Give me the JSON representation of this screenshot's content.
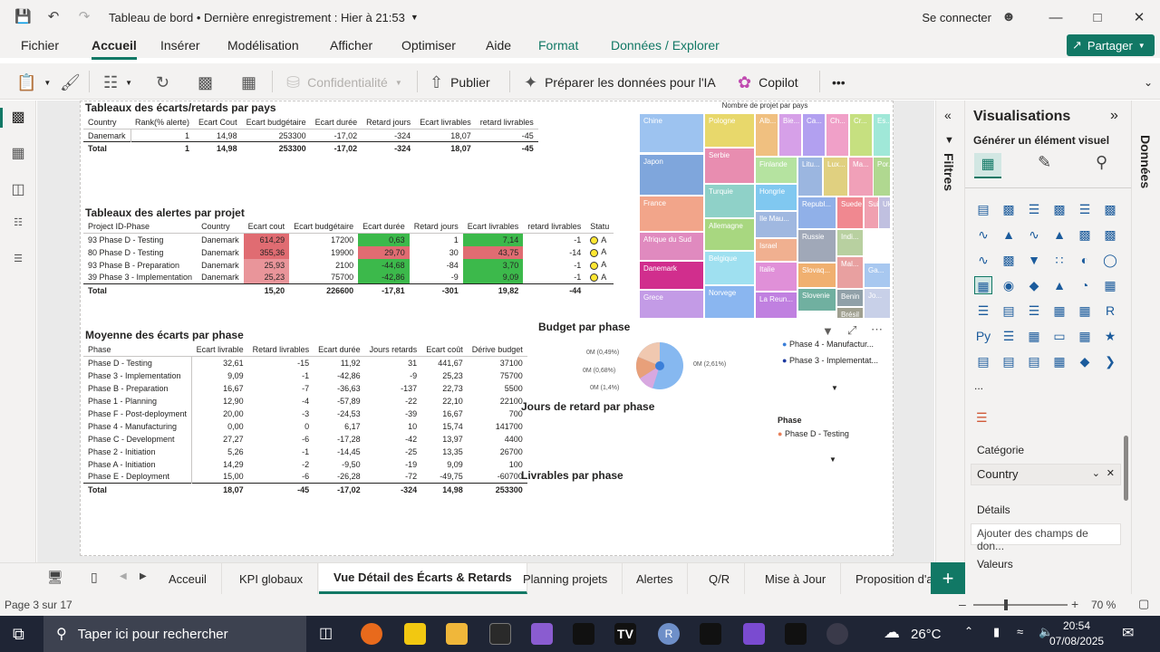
{
  "titlebar": {
    "title": "Tableau de bord • Dernière enregistrement : Hier à 21:53",
    "signin": "Se connecter"
  },
  "menu": {
    "tabs": [
      "Fichier",
      "Accueil",
      "Insérer",
      "Modélisation",
      "Afficher",
      "Optimiser",
      "Aide",
      "Format",
      "Données / Explorer"
    ],
    "share": "Partager"
  },
  "ribbon": {
    "confidentiality": "Confidentialité",
    "publish": "Publier",
    "prepare_ai": "Préparer les données pour l'IA",
    "copilot": "Copilot",
    "more": "•••"
  },
  "visuals": {
    "ecarts_title": "Tableaux des écarts/retards par pays",
    "ecarts_headers": [
      "Country",
      "Rank(% alerte)",
      "Ecart Cout",
      "Ecart budgétaire",
      "Ecart durée",
      "Retard jours",
      "Ecart livrables",
      "retard livrables"
    ],
    "ecarts_rows": [
      [
        "Danemark",
        "1",
        "14,98",
        "253300",
        "-17,02",
        "-324",
        "18,07",
        "-45"
      ]
    ],
    "ecarts_total": [
      "Total",
      "1",
      "14,98",
      "253300",
      "-17,02",
      "-324",
      "18,07",
      "-45"
    ],
    "alertes_title": "Tableaux des alertes par projet",
    "alertes_headers": [
      "Project ID-Phase",
      "Country",
      "Ecart cout",
      "Ecart budgétaire",
      "Ecart durée",
      "Retard jours",
      "Ecart livrables",
      "retard livrables",
      "Statu"
    ],
    "alertes_rows": [
      [
        "93 Phase D - Testing",
        "Danemark",
        "614,29",
        "17200",
        "0,63",
        "1",
        "7,14",
        "-1",
        "A"
      ],
      [
        "80 Phase D - Testing",
        "Danemark",
        "355,36",
        "19900",
        "29,70",
        "30",
        "43,75",
        "-14",
        "A"
      ],
      [
        "93 Phase B - Preparation",
        "Danemark",
        "25,93",
        "2100",
        "-44,68",
        "-84",
        "3,70",
        "-1",
        "A"
      ],
      [
        "39 Phase 3 - Implementation",
        "Danemark",
        "25,23",
        "75700",
        "-42,86",
        "-9",
        "9,09",
        "-1",
        "A"
      ]
    ],
    "alertes_total": [
      "Total",
      "",
      "15,20",
      "226600",
      "-17,81",
      "-301",
      "19,82",
      "-44",
      ""
    ],
    "moyenne_title": "Moyenne des écarts par phase",
    "moyenne_headers": [
      "Phase",
      "Ecart livrable",
      "Retard livrables",
      "Ecart durée",
      "Jours retards",
      "Ecart coût",
      "Dérive budget"
    ],
    "moyenne_rows": [
      [
        "Phase D - Testing",
        "32,61",
        "-15",
        "11,92",
        "31",
        "441,67",
        "37100"
      ],
      [
        "Phase 3 - Implementation",
        "9,09",
        "-1",
        "-42,86",
        "-9",
        "25,23",
        "75700"
      ],
      [
        "Phase B - Preparation",
        "16,67",
        "-7",
        "-36,63",
        "-137",
        "22,73",
        "5500"
      ],
      [
        "Phase 1 - Planning",
        "12,90",
        "-4",
        "-57,89",
        "-22",
        "22,10",
        "22100"
      ],
      [
        "Phase F - Post-deployment",
        "20,00",
        "-3",
        "-24,53",
        "-39",
        "16,67",
        "700"
      ],
      [
        "Phase 4 - Manufacturing",
        "0,00",
        "0",
        "6,17",
        "10",
        "15,74",
        "141700"
      ],
      [
        "Phase C - Development",
        "27,27",
        "-6",
        "-17,28",
        "-42",
        "13,97",
        "4400"
      ],
      [
        "Phase 2 - Initiation",
        "5,26",
        "-1",
        "-14,45",
        "-25",
        "13,35",
        "26700"
      ],
      [
        "Phase A - Initiation",
        "14,29",
        "-2",
        "-9,50",
        "-19",
        "9,09",
        "100"
      ],
      [
        "Phase E - Deployment",
        "15,00",
        "-6",
        "-26,28",
        "-72",
        "-49,75",
        "-60700"
      ]
    ],
    "moyenne_total": [
      "Total",
      "18,07",
      "-45",
      "-17,02",
      "-324",
      "14,98",
      "253300"
    ],
    "treemap_title": "Nombre de projet par pays",
    "treemap_cells": [
      {
        "label": "Chine",
        "color": "#9dc3f0"
      },
      {
        "label": "Japon",
        "color": "#7fa6dc"
      },
      {
        "label": "France",
        "color": "#f2a58a"
      },
      {
        "label": "Afrique du Sud",
        "color": "#e08abf"
      },
      {
        "label": "Danemark",
        "color": "#d12e8d"
      },
      {
        "label": "Grece",
        "color": "#c39be6"
      },
      {
        "label": "Pologne",
        "color": "#e8d86b"
      },
      {
        "label": "Serbie",
        "color": "#e88db0"
      },
      {
        "label": "Turquie",
        "color": "#8fd1c8"
      },
      {
        "label": "Allemagne",
        "color": "#a8d780"
      },
      {
        "label": "Belgique",
        "color": "#9fe0f0"
      },
      {
        "label": "Norvege",
        "color": "#8ab6f0"
      },
      {
        "label": "Alb...",
        "color": "#f0c080"
      },
      {
        "label": "Bie...",
        "color": "#d6a0e8"
      },
      {
        "label": "Ca...",
        "color": "#b2a0f0"
      },
      {
        "label": "Ch...",
        "color": "#f0a0c8"
      },
      {
        "label": "Cr...",
        "color": "#c6e080"
      },
      {
        "label": "Es...",
        "color": "#a0e8d8"
      },
      {
        "label": "Finlande",
        "color": "#b5e3a0"
      },
      {
        "label": "Litu...",
        "color": "#9bb6e0"
      },
      {
        "label": "Lux...",
        "color": "#e0d080"
      },
      {
        "label": "Ma...",
        "color": "#f0a0b8"
      },
      {
        "label": "Ma...",
        "color": "#98e0c8"
      },
      {
        "label": "Por...",
        "color": "#b0d890"
      },
      {
        "label": "Hongrie",
        "color": "#80c8f0"
      },
      {
        "label": "Ile Mau...",
        "color": "#a0b8e0"
      },
      {
        "label": "Israel",
        "color": "#f0b090"
      },
      {
        "label": "Italie",
        "color": "#e090d8"
      },
      {
        "label": "La Reun...",
        "color": "#c080e0"
      },
      {
        "label": "Republ...",
        "color": "#90b0e8"
      },
      {
        "label": "Suede",
        "color": "#f08890"
      },
      {
        "label": "Suisse",
        "color": "#f0a0b0"
      },
      {
        "label": "Ukra...",
        "color": "#c0c0e0"
      },
      {
        "label": "Russie",
        "color": "#a0a8b8"
      },
      {
        "label": "Indi...",
        "color": "#b8d0a0"
      },
      {
        "label": "Slovaq...",
        "color": "#f0b070"
      },
      {
        "label": "Mal...",
        "color": "#e8a0a0"
      },
      {
        "label": "Slovenie",
        "color": "#70b0a0"
      },
      {
        "label": "Benin",
        "color": "#90a0a8"
      },
      {
        "label": "Brésil",
        "color": "#a0a090"
      },
      {
        "label": "Ga...",
        "color": "#a8c8f0"
      },
      {
        "label": "Jo...",
        "color": "#c8d0e8"
      }
    ],
    "budget_title": "Budget par phase",
    "budget_labels": [
      "0M (0,49%)",
      "0M (0,68%)",
      "0M (1,4%)",
      "0M (2,61%)"
    ],
    "budget_legend": [
      "Phase 4 - Manufactur...",
      "Phase 3 - Implementat..."
    ],
    "jours_title": "Jours de retard par phase",
    "jours_legend_title": "Phase",
    "jours_legend": [
      "Phase D - Testing"
    ],
    "livrables_title": "Livrables par phase"
  },
  "panes": {
    "filters": "Filtres",
    "viz_title": "Visualisations",
    "generate": "Générer un élément visuel",
    "data": "Données",
    "category_label": "Catégorie",
    "category_value": "Country",
    "details_label": "Détails",
    "details_placeholder": "Ajouter des champs de don...",
    "values_label": "Valeurs",
    "more": "..."
  },
  "pagetabs": {
    "tabs": [
      "Acceuil",
      "KPI globaux",
      "Vue Détail des Écarts & Retards",
      "Planning projets",
      "Alertes",
      "Q/R",
      "Mise à Jour",
      "Proposition d'a"
    ],
    "active_index": 2,
    "add": "+"
  },
  "status": {
    "page": "Page 3 sur 17",
    "zoom": "70 %"
  },
  "taskbar": {
    "search": "Taper ici pour rechercher",
    "weather": "26°C",
    "time": "20:54",
    "date": "07/08/2025"
  },
  "colors": {
    "accent": "#117865",
    "pie": [
      "#86b8f0",
      "#3b7fd9",
      "#e8a07a",
      "#d8a8e0",
      "#f0c8b0"
    ]
  }
}
